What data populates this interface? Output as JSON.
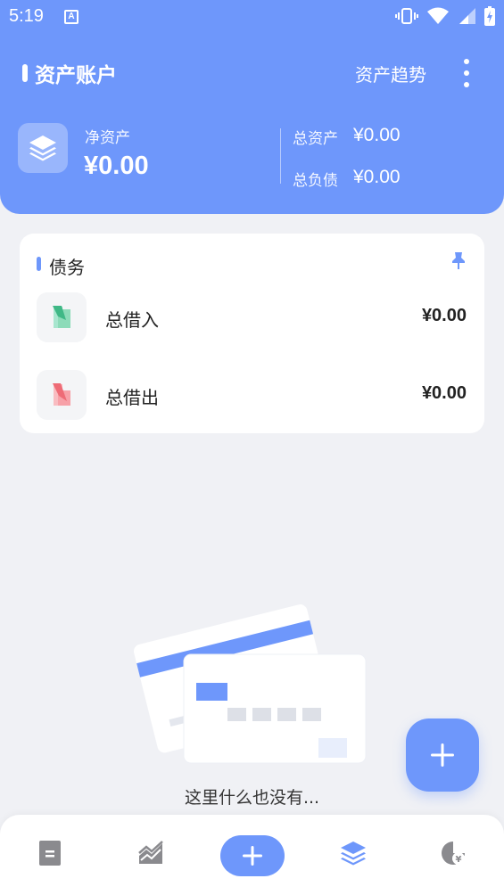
{
  "status_bar": {
    "time": "5:19",
    "a_icon": "A"
  },
  "header": {
    "title": "资产账户",
    "trend_label": "资产趋势",
    "net_assets_label": "净资产",
    "net_assets_value": "¥0.00",
    "total_assets_label": "总资产",
    "total_assets_value": "¥0.00",
    "total_liabilities_label": "总负债",
    "total_liabilities_value": "¥0.00"
  },
  "debt_card": {
    "title": "债务",
    "rows": [
      {
        "label": "总借入",
        "value": "¥0.00",
        "icon": "borrow-in-icon"
      },
      {
        "label": "总借出",
        "value": "¥0.00",
        "icon": "lend-out-icon"
      }
    ]
  },
  "empty_state": {
    "text": "这里什么也没有..."
  },
  "colors": {
    "accent": "#6e97fb",
    "background": "#f0f1f5",
    "borrow_in": "#5cc7a0",
    "lend_out": "#f07d85"
  },
  "bottom_nav": {
    "items": [
      {
        "icon": "ledger-icon"
      },
      {
        "icon": "chart-icon"
      },
      {
        "icon": "add-icon"
      },
      {
        "icon": "layers-icon"
      },
      {
        "icon": "piggy-bank-icon"
      }
    ]
  }
}
